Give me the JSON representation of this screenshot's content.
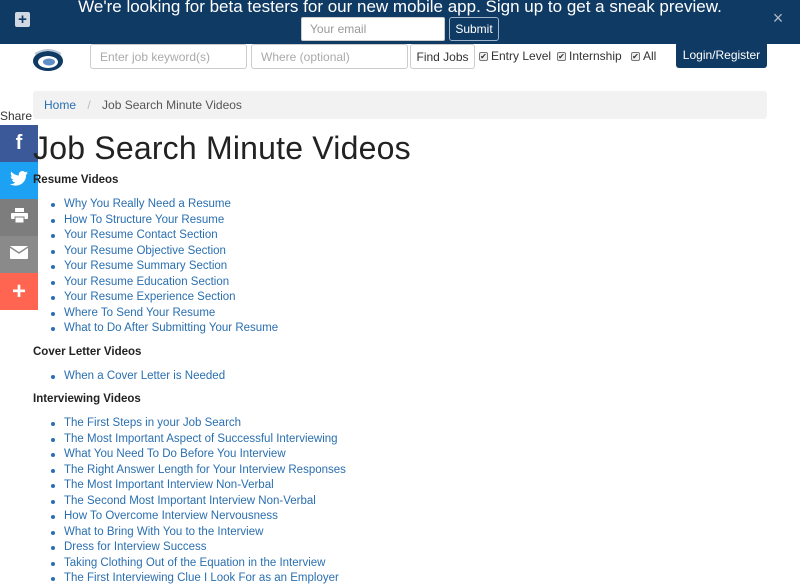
{
  "beta_banner": {
    "message": "We're looking for beta testers for our new mobile app. Sign up to get a sneak preview.",
    "email_placeholder": "Your email",
    "submit_label": "Submit",
    "close_symbol": "×",
    "expand_symbol": "+"
  },
  "topnav": {
    "keyword_placeholder": "Enter job keyword(s)",
    "where_placeholder": "Where (optional)",
    "find_label": "Find Jobs",
    "filters": [
      {
        "label": "Entry Level",
        "checked": true
      },
      {
        "label": "Internship",
        "checked": true
      },
      {
        "label": "All",
        "checked": true
      }
    ],
    "login_label": "Login/Register"
  },
  "breadcrumb": {
    "home": "Home",
    "separator": "/",
    "current": "Job Search Minute Videos"
  },
  "share": {
    "label": "Share",
    "buttons": [
      {
        "name": "facebook",
        "glyph": "f",
        "color": "#3b5998"
      },
      {
        "name": "twitter",
        "icon": "twitter-bird-icon",
        "color": "#1da1f2"
      },
      {
        "name": "print",
        "icon": "printer-icon",
        "color": "#7d7d7d"
      },
      {
        "name": "email",
        "icon": "envelope-icon",
        "color": "#8a8a8a"
      },
      {
        "name": "more",
        "glyph": "+",
        "color": "#ff6550"
      }
    ]
  },
  "page": {
    "title": "Job Search Minute Videos",
    "sections": [
      {
        "heading": "Resume Videos",
        "videos": [
          "Why You Really Need a Resume",
          "How To Structure Your Resume",
          "Your Resume Contact Section",
          "Your Resume Objective Section",
          "Your Resume Summary Section",
          "Your Resume Education Section",
          "Your Resume Experience Section",
          "Where To Send Your Resume",
          "What to Do After Submitting Your Resume"
        ]
      },
      {
        "heading": "Cover Letter Videos",
        "videos": [
          "When a Cover Letter is Needed"
        ]
      },
      {
        "heading": "Interviewing Videos",
        "videos": [
          "The First Steps in your Job Search",
          "The Most Important Aspect of Successful Interviewing",
          "What You Need To Do Before You Interview",
          "The Right Answer Length for Your Interview Responses",
          "The Most Important Interview Non-Verbal",
          "The Second Most Important Interview Non-Verbal",
          "How To Overcome Interview Nervousness",
          "What to Bring With You to the Interview",
          "Dress for Interview Success",
          "Taking Clothing Out of the Equation in the Interview",
          "The First Interviewing Clue I Look For as an Employer"
        ]
      }
    ]
  },
  "colors": {
    "brand_navy": "#0f3a63",
    "link_blue": "#2a6fb0"
  }
}
